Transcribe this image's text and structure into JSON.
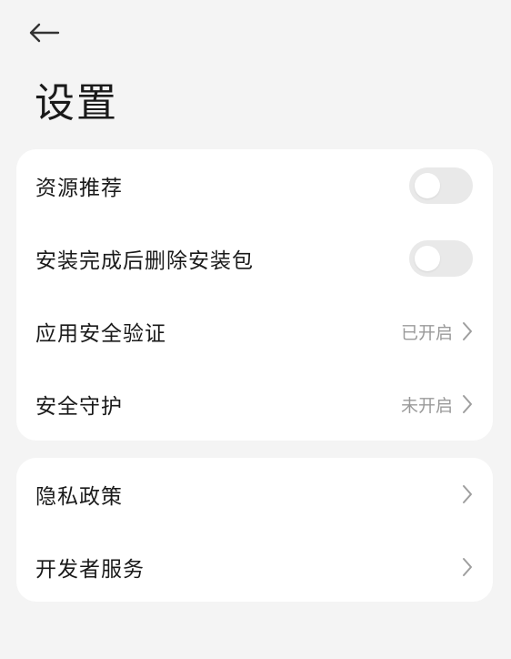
{
  "header": {
    "back_icon": "arrow-left-icon",
    "title": "设置"
  },
  "sections": [
    {
      "items": [
        {
          "label": "资源推荐",
          "type": "toggle",
          "on": false
        },
        {
          "label": "安装完成后删除安装包",
          "type": "toggle",
          "on": false
        },
        {
          "label": "应用安全验证",
          "type": "link",
          "value": "已开启",
          "icon": "chevron-right-icon"
        },
        {
          "label": "安全守护",
          "type": "link",
          "value": "未开启",
          "icon": "chevron-right-icon"
        }
      ]
    },
    {
      "items": [
        {
          "label": "隐私政策",
          "type": "link",
          "icon": "chevron-right-icon"
        },
        {
          "label": "开发者服务",
          "type": "link",
          "icon": "chevron-right-icon"
        }
      ]
    }
  ],
  "colors": {
    "background": "#f4f4f4",
    "card": "#ffffff",
    "toggle_off": "#e9e9e9",
    "secondary_text": "#9a9a9a",
    "chevron": "#9e9e9e"
  }
}
